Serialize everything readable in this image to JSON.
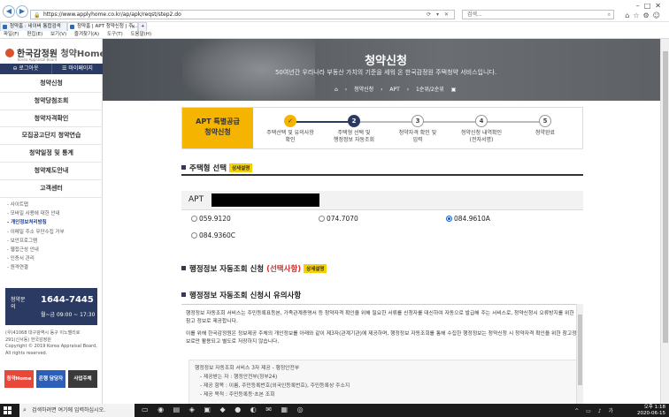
{
  "browser": {
    "url": "https://www.applyhome.co.kr/ap/apk/reqst/step2.do",
    "search_placeholder": "검색...",
    "tabs": [
      "청약홈 : 네이버 통합검색",
      "청약홈 | APT 청약신청 | 주..."
    ],
    "menu": [
      "파일(F)",
      "편집(E)",
      "보기(V)",
      "즐겨찾기(A)",
      "도구(T)",
      "도움말(H)"
    ]
  },
  "sidebar": {
    "logo_text": "한국감정원",
    "logo_home": "청약Home",
    "logo_sub": "Korea Appraisal Board",
    "login_label": "로그아웃",
    "mypage_label": "마이페이지",
    "menu": [
      "청약신청",
      "청약당첨조회",
      "청약자격확인",
      "모집공고단지 청약연습",
      "청약일정 및 통계",
      "청약제도안내",
      "고객센터"
    ],
    "links": [
      "사이트맵",
      "모바일 사용에 대한 안내",
      "개인정보처리방침",
      "이메일 주소 무단수집 거부",
      "보안프로그램",
      "웹접근성 안내",
      "인증서 관리",
      "원격연결"
    ],
    "cs_label": "청약문의",
    "cs_number": "1644-7445",
    "cs_hours": "월~금 09:00 ~ 17:30",
    "address": [
      "(우)41068 대구광역시 동구 이노밸리로",
      "291(신서동) 한국감정원",
      "Copyright © 2019 Korea Appraisal Board,",
      "All rights reserved."
    ],
    "footer_buttons": [
      "청약Home",
      "은행 담당자",
      "사업주체"
    ]
  },
  "hero": {
    "title": "청약신청",
    "subtitle": "50여년간 우리나라 부동산 가치의 기준을 세워 온 한국감정원 주택청약 서비스입니다.",
    "breadcrumb": [
      "청약신청",
      "APT",
      "1순위/2순위"
    ]
  },
  "steps": {
    "label_line1": "APT 특별공급",
    "label_line2": "청약신청",
    "items": [
      {
        "num": "✓",
        "line1": "주택선택 및 유의사항",
        "line2": "확인"
      },
      {
        "num": "2",
        "line1": "주택형 선택 및",
        "line2": "행정정보 자동조회"
      },
      {
        "num": "3",
        "line1": "청약자격 확인 및",
        "line2": "입력"
      },
      {
        "num": "4",
        "line1": "청약신청 내역확인",
        "line2": "(전자서명)"
      },
      {
        "num": "5",
        "line1": "청약완료",
        "line2": ""
      }
    ]
  },
  "housing": {
    "title": "주택형 선택",
    "detail_badge": "상세설명",
    "apt_label": "APT",
    "options": [
      "059.9120",
      "074.7070",
      "084.9610A",
      "084.9360C"
    ],
    "selected": "084.9610A"
  },
  "admin": {
    "title": "행정정보 자동조회 신청",
    "optional": "(선택사항)",
    "detail_badge": "상세설명",
    "notice_title": "행정정보 자동조회 신청시 유의사항",
    "paragraph1": "행정정보 자동조회 서비스는 주민등록표등본, 가족관계증명서 등 청약자격 확인을 위해 필요한 서류를 신청자를 대신하여 자동으로 발급해 주는 서비스로, 청약신청시 오류방지를 위한 참고 정보로 제공합니다.",
    "paragraph2": "이를 위해 한국감정원은 정보제공 주체의 개인정보를 아래와 같이 제3자(관계기관)에 제공하며, 행정정보 자동조회를 통해 수집한 행정정보는 청약신청 시 청약자격 확인을 위한 참고정보로만 활용되고 별도로 저장하지 않습니다.",
    "box_lines": [
      "행정정보 자동조회 서비스 3자 제공 - 행정안전부",
      "- 제공받는 자 : 행정안전부(정부24)",
      "- 제공 항목 : 이름, 주민등록번호(외국인등록번호), 주민등록상 주소지",
      "- 제공 목적 : 주민등록등·초본 조회"
    ]
  },
  "taskbar": {
    "search_placeholder": "검색하려면 여기에 입력하십시오.",
    "time": "오후 1:18",
    "date": "2020-06-15"
  },
  "colors": {
    "navy": "#2b3a62",
    "yellow": "#f4b400",
    "red": "#d32f2f"
  }
}
